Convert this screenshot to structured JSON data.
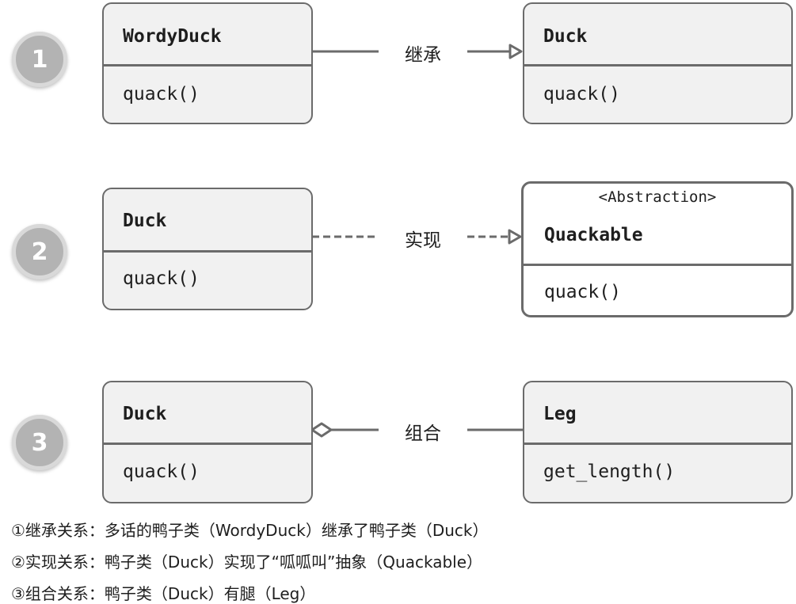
{
  "badges": [
    "1",
    "2",
    "3"
  ],
  "row1": {
    "left": {
      "name": "WordyDuck",
      "method": "quack()"
    },
    "label": "继承",
    "right": {
      "name": "Duck",
      "method": "quack()"
    }
  },
  "row2": {
    "left": {
      "name": "Duck",
      "method": "quack()"
    },
    "label": "实现",
    "right": {
      "stereotype": "<Abstraction>",
      "name": "Quackable",
      "method": "quack()"
    }
  },
  "row3": {
    "left": {
      "name": "Duck",
      "method": "quack()"
    },
    "label": "组合",
    "right": {
      "name": "Leg",
      "method": "get_length()"
    }
  },
  "captions": [
    "①继承关系：多话的鸭子类（WordyDuck）继承了鸭子类（Duck）",
    "②实现关系：鸭子类（Duck）实现了“呱呱叫”抽象（Quackable）",
    "③组合关系：鸭子类（Duck）有腿（Leg）"
  ],
  "colors": {
    "line": "#6b6b6b",
    "box_fill": "#f1f1f1",
    "badge": "#b3b3b3"
  }
}
